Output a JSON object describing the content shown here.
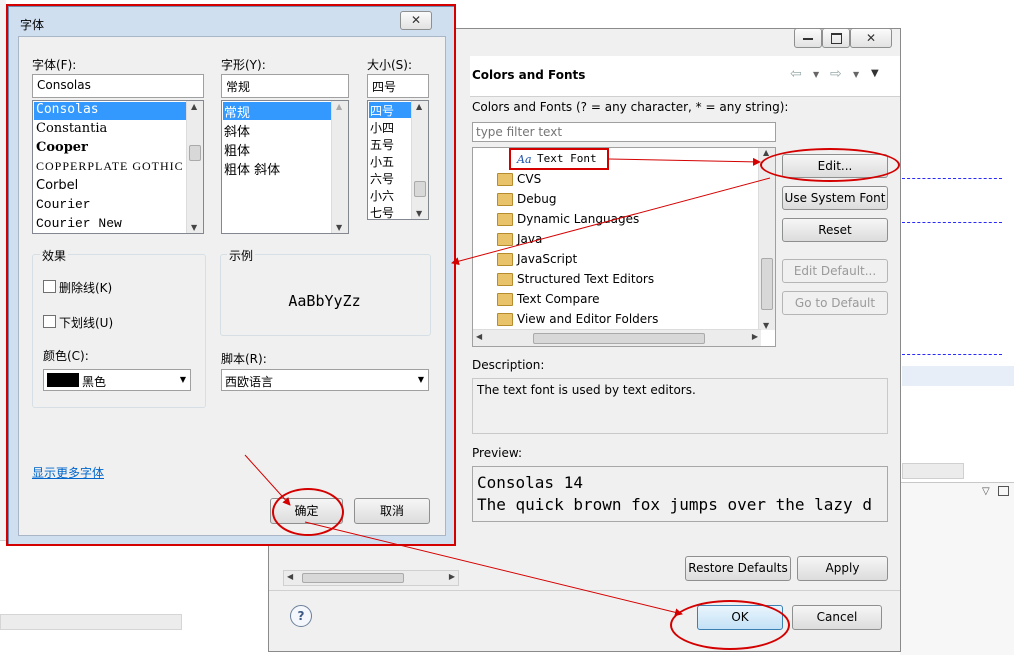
{
  "font_dialog": {
    "title": "字体",
    "font_label": "字体(F):",
    "font_value": "Consolas",
    "font_list": [
      "Consolas",
      "Constantia",
      "Cooper",
      "COPPERPLATE GOTHIC",
      "Corbel",
      "Courier",
      "Courier New"
    ],
    "style_label": "字形(Y):",
    "style_value": "常规",
    "style_list": [
      "常规",
      "斜体",
      "粗体",
      "粗体 斜体"
    ],
    "size_label": "大小(S):",
    "size_value": "四号",
    "size_list": [
      "四号",
      "小四",
      "五号",
      "小五",
      "六号",
      "小六",
      "七号"
    ],
    "effects_label": "效果",
    "strike_label": "删除线(K)",
    "underline_label": "下划线(U)",
    "color_label": "颜色(C):",
    "color_value": "黑色",
    "color_swatch": "#000000",
    "sample_label": "示例",
    "sample_text": "AaBbYyZz",
    "script_label": "脚本(R):",
    "script_value": "西欧语言",
    "more_fonts_link": "显示更多字体",
    "ok_label": "确定",
    "cancel_label": "取消",
    "close_icon": "close-icon"
  },
  "prefs": {
    "title": "Colors and Fonts",
    "description_header": "Colors and Fonts (? = any character, * = any string):",
    "filter_placeholder": "type filter text",
    "tree": [
      "Text Font",
      "CVS",
      "Debug",
      "Dynamic Languages",
      "Java",
      "JavaScript",
      "Structured Text Editors",
      "Text Compare",
      "View and Editor Folders"
    ],
    "buttons": {
      "edit": "Edit...",
      "use_system_font": "Use System Font",
      "reset": "Reset",
      "edit_default": "Edit Default...",
      "go_to_default": "Go to Default"
    },
    "description_label": "Description:",
    "description_text": "The text font is used by text editors.",
    "preview_label": "Preview:",
    "preview_line1": "Consolas 14",
    "preview_line2": "The quick brown fox jumps over the lazy d",
    "restore_defaults": "Restore Defaults",
    "apply": "Apply",
    "ok": "OK",
    "cancel": "Cancel",
    "accent": "#d40000"
  }
}
